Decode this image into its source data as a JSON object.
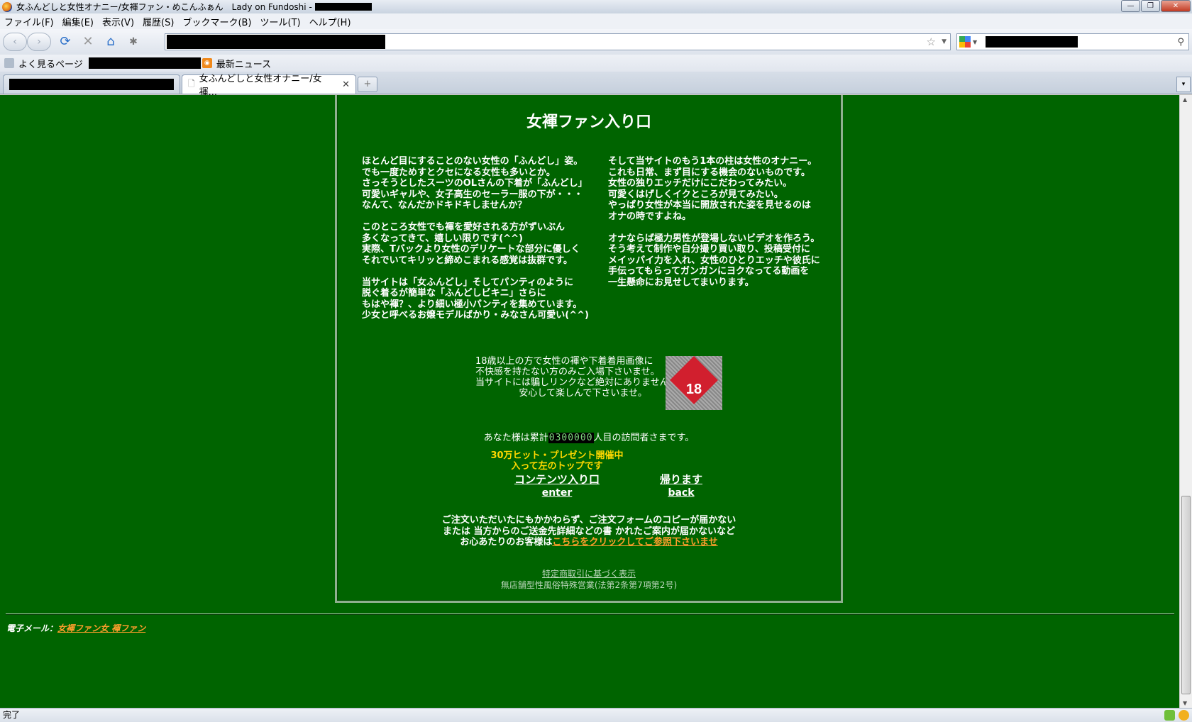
{
  "window": {
    "title": "女ふんどしと女性オナニー/女褌ファン・めこんふぁん　Lady on Fundoshi -",
    "controls": [
      "—",
      "❐",
      "✕"
    ]
  },
  "menu": [
    "ファイル(F)",
    "編集(E)",
    "表示(V)",
    "履歴(S)",
    "ブックマーク(B)",
    "ツール(T)",
    "ヘルプ(H)"
  ],
  "bookmarks": {
    "most_visited": "よく見るページ",
    "latest_news": "最新ニュース"
  },
  "tabs": {
    "active_title": "女ふんどしと女性オナニー/女褌...",
    "close": "✕",
    "new_tab": "+",
    "list": "▾"
  },
  "page": {
    "title": "女褌ファン入り口",
    "left_column": "ほとんど目にすることのない女性の「ふんどし」姿。\nでも一度ためすとクセになる女性も多いとか。\nさっそうとしたスーツのOLさんの下着が「ふんどし」\n可愛いギャルや、女子高生のセーラー服の下が・・・\nなんて、なんだかドキドキしませんか？\n\nこのところ女性でも褌を愛好される方がずいぶん\n多くなってきて、嬉しい限りです(^^)\n実際、Tバックより女性のデリケートな部分に優しく\nそれでいてキリッと締めこまれる感覚は抜群です。\n\n当サイトは「女ふんどし」そしてパンティのように\n脱ぐ着るが簡単な「ふんどしビキニ」さらに\nもはや褌？、より細い極小パンティを集めています。\n少女と呼べるお嬢モデルばかり・みなさん可愛い(^^)",
    "right_column": "そして当サイトのもう1本の柱は女性のオナニー。\nこれも日常、まず目にする機会のないものです。\n女性の独りエッチだけにこだわってみたい。\n可愛くはげしくイクところが見てみたい。\nやっぱり女性が本当に開放された姿を見せるのは\nオナの時ですよね。\n\nオナならば極力男性が登場しないビデオを作ろう。\nそう考えて制作や自分撮り買い取り、投稿受付に\nメイッパイ力を入れ、女性のひとりエッチや彼氏に\n手伝ってもらってガンガンにヨクなってる動画を\n一生懸命にお見せしてまいります。",
    "age_notice": "18歳以上の方で女性の褌や下着着用画像に\n不快感を持たない方のみご入場下さいませ。\n当サイトには騙しリンクなど絶対にありません。\n安心して楽しんで下さいませ。",
    "age_badge": "18",
    "counter_prefix": "あなた様は累計",
    "counter_value": "0300000",
    "counter_suffix": "人目の訪問者さまです。",
    "promo": "30万ヒット・プレゼント開催中\n入って左のトップです",
    "enter_jp": "コンテンツ入り口",
    "enter_en": "enter",
    "back_jp": "帰ります",
    "back_en": "back",
    "order_line1": "ご注文いただいたにもかかわらず、ご注文フォームのコピーが届かない",
    "order_line2": "または 当方からのご送金先詳細などの書 かれたご案内が届かないなど",
    "order_line3": "お心あたりのお客様は",
    "order_link": "こちらをクリックしてご参照下さいませ",
    "legal_link": "特定商取引に基づく表示",
    "legal_text": "無店舗型性風俗特殊営業(法第2条第7項第2号)",
    "email_label": "電子メール：",
    "email_link": "女褌ファン女 褌ファン"
  },
  "status": {
    "text": "完了"
  },
  "colors": {
    "page_bg": "#006400",
    "promo": "#ffd800",
    "link_orange": "#ff9e2c"
  }
}
